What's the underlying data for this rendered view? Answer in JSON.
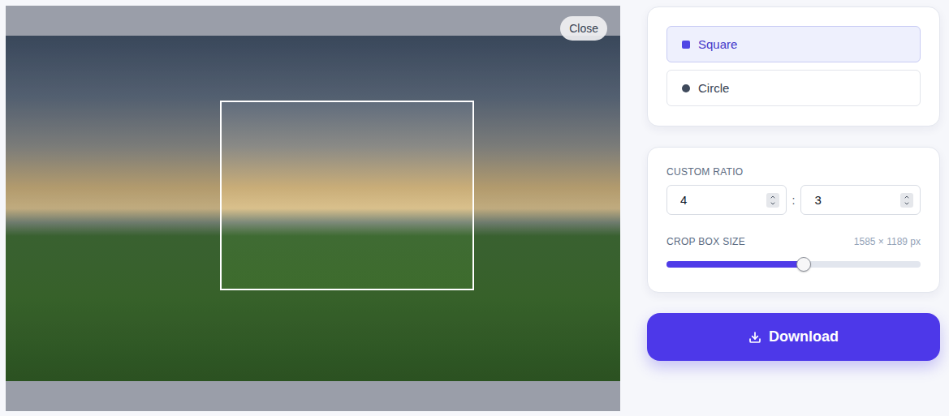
{
  "close_button": "Close",
  "shapes": [
    {
      "label": "Square",
      "kind": "square",
      "selected": true
    },
    {
      "label": "Circle",
      "kind": "circle",
      "selected": false
    }
  ],
  "ratio": {
    "label": "CUSTOM RATIO",
    "width": "4",
    "separator": ":",
    "height": "3"
  },
  "crop_size": {
    "label": "CROP BOX SIZE",
    "reading": "1585 × 1189 px",
    "level": 0.54
  },
  "download_button": "Download"
}
